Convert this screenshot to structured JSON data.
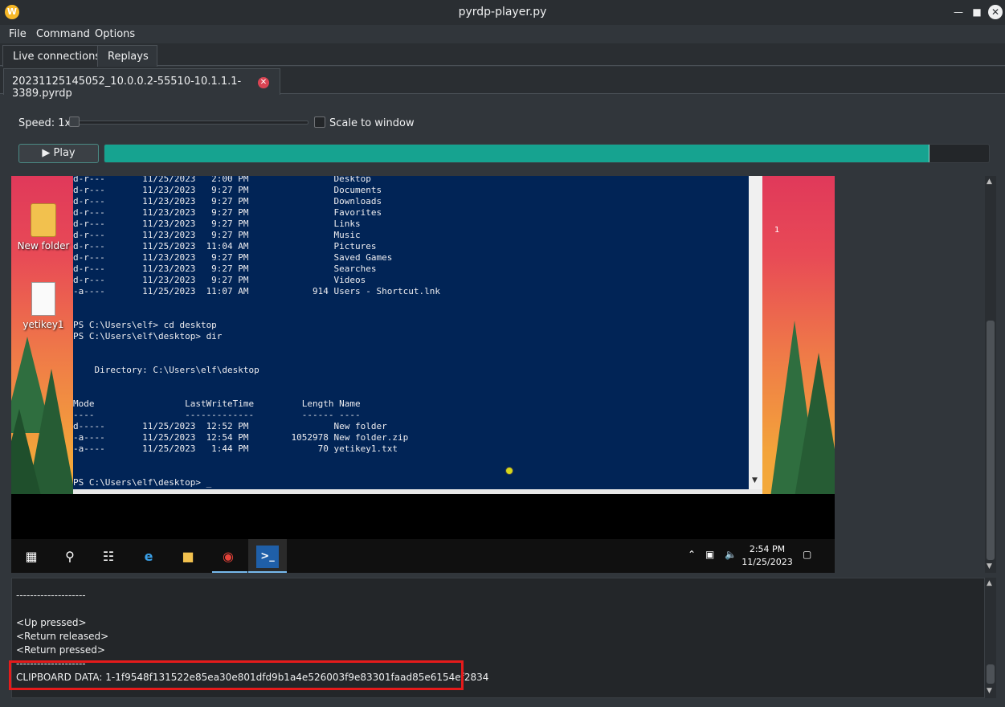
{
  "window": {
    "title": "pyrdp-player.py",
    "icon_letter": "W"
  },
  "menu": {
    "file": "File",
    "command": "Command",
    "options": "Options"
  },
  "tabs": {
    "live": "Live connections",
    "replays": "Replays"
  },
  "file_tab": {
    "name": "20231125145052_10.0.0.2-55510-10.1.1.1-3389.pyrdp"
  },
  "controls": {
    "speed_label": "Speed: 1x",
    "scale_label": "Scale to window",
    "scale_checked": false,
    "play_label": "▶ Play",
    "progress_fraction": 0.933
  },
  "desktop": {
    "icons": [
      {
        "label": "New folder",
        "icon": "folder-icon"
      },
      {
        "label": "yetikey1",
        "icon": "text-file-icon"
      }
    ],
    "right_label": "1"
  },
  "powershell": {
    "lines": [
      "d-r---       11/25/2023   2:00 PM                Desktop",
      "d-r---       11/23/2023   9:27 PM                Documents",
      "d-r---       11/23/2023   9:27 PM                Downloads",
      "d-r---       11/23/2023   9:27 PM                Favorites",
      "d-r---       11/23/2023   9:27 PM                Links",
      "d-r---       11/23/2023   9:27 PM                Music",
      "d-r---       11/25/2023  11:04 AM                Pictures",
      "d-r---       11/23/2023   9:27 PM                Saved Games",
      "d-r---       11/23/2023   9:27 PM                Searches",
      "d-r---       11/23/2023   9:27 PM                Videos",
      "-a----       11/25/2023  11:07 AM            914 Users - Shortcut.lnk",
      "",
      "",
      "PS C:\\Users\\elf> cd desktop",
      "PS C:\\Users\\elf\\desktop> dir",
      "",
      "",
      "    Directory: C:\\Users\\elf\\desktop",
      "",
      "",
      "Mode                 LastWriteTime         Length Name",
      "----                 -------------         ------ ----",
      "d-----       11/25/2023  12:52 PM                New folder",
      "-a----       11/25/2023  12:54 PM        1052978 New folder.zip",
      "-a----       11/25/2023   1:44 PM             70 yetikey1.txt",
      "",
      "",
      "PS C:\\Users\\elf\\desktop> _"
    ]
  },
  "taskbar": {
    "time": "2:54 PM",
    "date": "11/25/2023",
    "icons": [
      "windows-start-icon",
      "search-icon",
      "task-view-icon",
      "internet-explorer-icon",
      "file-explorer-icon",
      "chrome-icon",
      "powershell-icon"
    ]
  },
  "log": {
    "lines": [
      "--------------------",
      "",
      "<Up pressed>",
      "<Return released>",
      "<Return pressed>",
      "--------------------",
      "CLIPBOARD DATA: 1-1f9548f131522e85ea30e801dfd9b1a4e526003f9e83301faad85e6154ef2834"
    ]
  },
  "colors": {
    "accent": "#16a390",
    "ps_background": "#012456",
    "highlight": "#e51b1b"
  }
}
